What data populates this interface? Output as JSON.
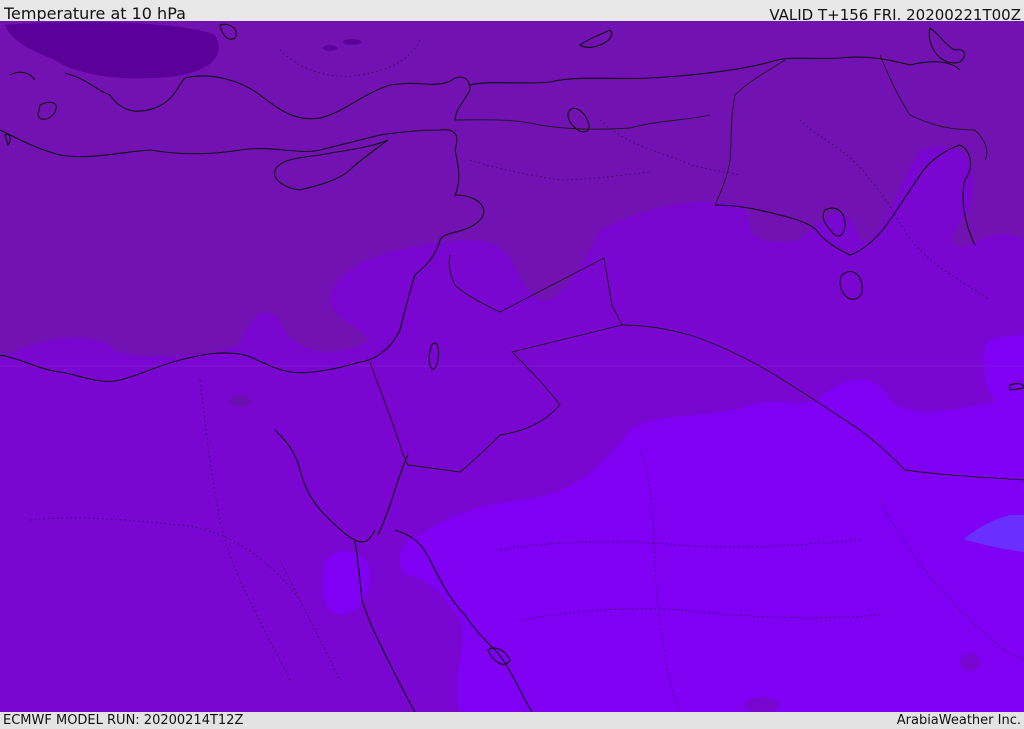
{
  "header": {
    "title": "Temperature at 10 hPa",
    "valid": "VALID T+156 FRI. 20200221T00Z"
  },
  "footer": {
    "model_run": "ECMWF MODEL RUN: 20200214T12Z",
    "credit": "ArabiaWeather Inc."
  },
  "map": {
    "field": "temperature",
    "level": "10 hPa",
    "colors": {
      "coldest": "#5b0099",
      "cold": "#7312b2",
      "mid": "#7a06d2",
      "warm": "#8000f4",
      "warmer": "#8a1aff",
      "warmest": "#6a2eff",
      "coastline": "#111111",
      "border": "#1a1a1a"
    }
  }
}
